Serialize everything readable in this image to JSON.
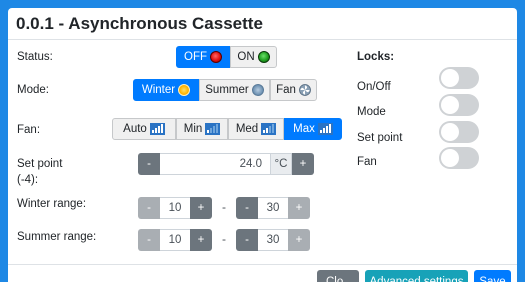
{
  "modal": {
    "title": "0.0.1 - Asynchronous Cassette"
  },
  "status": {
    "label": "Status:",
    "off": "OFF",
    "on": "ON",
    "selected": "OFF"
  },
  "mode": {
    "label": "Mode:",
    "options": [
      "Winter",
      "Summer",
      "Fan"
    ],
    "selected": "Winter"
  },
  "fan": {
    "label": "Fan:",
    "options": [
      "Auto",
      "Min",
      "Med",
      "Max"
    ],
    "selected": "Max"
  },
  "setpoint": {
    "label": "Set point",
    "sublabel": "(-4):",
    "minus": "-",
    "value": "24.0",
    "unit": "°C",
    "plus": "+"
  },
  "winter_range": {
    "label": "Winter range:",
    "min": "10",
    "max": "30",
    "minus": "-",
    "plus": "+",
    "sep": "-"
  },
  "summer_range": {
    "label": "Summer range:",
    "min": "10",
    "max": "30",
    "minus": "-",
    "plus": "+",
    "sep": "-"
  },
  "locks": {
    "title": "Locks:",
    "items": [
      {
        "label": "On/Off",
        "on": false
      },
      {
        "label": "Mode",
        "on": false
      },
      {
        "label": "Set point",
        "on": false
      },
      {
        "label": "Fan",
        "on": false
      }
    ]
  },
  "footer": {
    "close": "Clo",
    "advanced": "Advanced settings",
    "save": "Save"
  },
  "colors": {
    "primary": "#007bff",
    "teal": "#17a2b8",
    "secondary": "#6c757d",
    "background": "#1e88e5"
  }
}
